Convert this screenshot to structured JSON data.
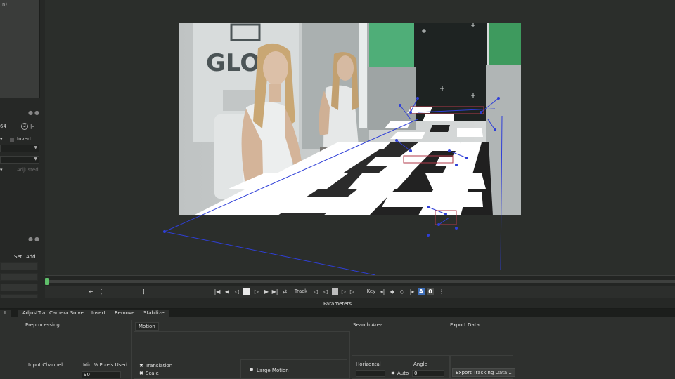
{
  "left_panel": {
    "top_label": "n)",
    "value_label": "64",
    "invert_label": "Invert",
    "adjusted_label": "Adjusted",
    "set_label": "Set",
    "add_label": "Add"
  },
  "viewer": {
    "plate_sign": "GLO"
  },
  "transport": {
    "track_label": "Track",
    "key_label": "Key",
    "a_label": "A",
    "zero_label": "0"
  },
  "parameters": {
    "header": "Parameters",
    "tabs": [
      "t",
      "AdjustTrack",
      "Camera Solve",
      "Insert",
      "Remove",
      "Stabilize"
    ],
    "preprocessing": {
      "title": "Preprocessing",
      "input_channel_label": "Input Channel",
      "min_pixels_label": "Min % Pixels Used",
      "min_pixels_value": "90"
    },
    "motion": {
      "title": "Motion",
      "translation_label": "Translation",
      "scale_label": "Scale",
      "large_motion_label": "Large Motion"
    },
    "search_area": {
      "title": "Search Area",
      "horizontal_label": "Horizontal",
      "angle_label": "Angle",
      "auto_label": "Auto",
      "angle_value": "0"
    },
    "export_data": {
      "title": "Export Data",
      "export_button": "Export Tracking Data..."
    }
  },
  "colors": {
    "track_blue": "#2f3fd8",
    "accent_green": "#5fbf6a",
    "bg_dark": "#2b2e2b"
  }
}
